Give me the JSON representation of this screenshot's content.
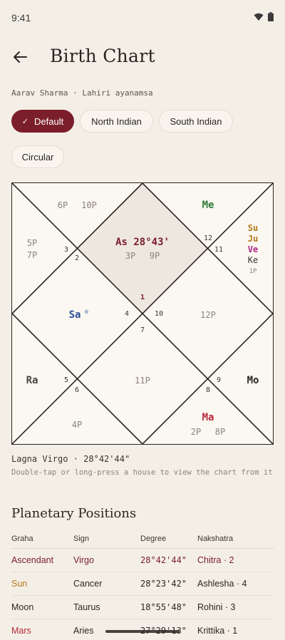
{
  "status": {
    "time": "9:41"
  },
  "header": {
    "title": "Birth Chart"
  },
  "subtitle": "Aarav Sharma · Lahiri ayanamsa",
  "chips": [
    {
      "label": "Default",
      "active": true
    },
    {
      "label": "North Indian",
      "active": false
    },
    {
      "label": "South Indian",
      "active": false
    },
    {
      "label": "Circular",
      "active": false
    }
  ],
  "chart": {
    "style": "North Indian",
    "house_numbers": [
      "1",
      "2",
      "3",
      "4",
      "5",
      "6",
      "7",
      "8",
      "9",
      "10",
      "11",
      "12"
    ],
    "ascendant": {
      "label": "As 28°43'",
      "color": "#7b1e2b"
    },
    "planets": {
      "me": {
        "label": "Me",
        "color": "#2f7a3a"
      },
      "su": {
        "label": "Su",
        "color": "#b5781c"
      },
      "ju": {
        "label": "Ju",
        "color": "#b5781c"
      },
      "ve": {
        "label": "Ve",
        "color": "#b0268a"
      },
      "ke": {
        "label": "Ke",
        "color": "#3a3430"
      },
      "sa": {
        "label": "Sa",
        "color": "#2d4f9a",
        "mark": "®"
      },
      "ra": {
        "label": "Ra",
        "color": "#4a4440"
      },
      "mo": {
        "label": "Mo",
        "color": "#2a2522"
      },
      "ma": {
        "label": "Ma",
        "color": "#b7283b"
      }
    },
    "points": {
      "h1": "3P",
      "h1b": "9P",
      "h2a": "6P",
      "h2b": "10P",
      "h3a": "5P",
      "h3b": "7P",
      "h5": "1P",
      "h6": "12P",
      "h7": "11P",
      "h8": "4P",
      "h9a": "2P",
      "h9b": "8P"
    }
  },
  "lagna": "Lagna Virgo · 28°42'44\"",
  "hint": "Double-tap or long-press a house to view the chart from it",
  "section_title": "Planetary Positions",
  "table": {
    "headers": [
      "Graha",
      "Sign",
      "Degree",
      "Nakshatra"
    ],
    "rows": [
      {
        "graha": "Ascendant",
        "sign": "Virgo",
        "degree": "28°42'44\"",
        "nakshatra": "Chitra · 2",
        "color": "#7b1e2b"
      },
      {
        "graha": "Sun",
        "sign": "Cancer",
        "degree": "28°23'42\"",
        "nakshatra": "Ashlesha · 4",
        "color": "#b5781c"
      },
      {
        "graha": "Moon",
        "sign": "Taurus",
        "degree": "18°55'48\"",
        "nakshatra": "Rohini · 3",
        "color": "#2a2522"
      },
      {
        "graha": "Mars",
        "sign": "Aries",
        "degree": "27°29'13\"",
        "nakshatra": "Krittika · 1",
        "color": "#b7283b"
      }
    ]
  }
}
